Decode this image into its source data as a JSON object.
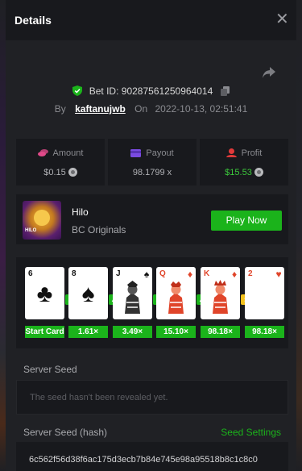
{
  "modal": {
    "title": "Details",
    "close_icon": "close-icon",
    "share_icon": "share-icon"
  },
  "bet": {
    "label": "Bet ID:",
    "id": "90287561250964014",
    "by_label": "By",
    "user": "kaftanujwb",
    "on_label": "On",
    "timestamp": "2022-10-13, 02:51:41"
  },
  "stats": [
    {
      "label": "Amount",
      "value": "$0.15",
      "icon": "coins-icon",
      "color": "#e14a8a"
    },
    {
      "label": "Payout",
      "value": "98.1799 x",
      "icon": "payout-card-icon",
      "color": "#7a4be0"
    },
    {
      "label": "Profit",
      "value": "$15.53",
      "icon": "profit-icon",
      "color": "#e03a3a"
    }
  ],
  "game": {
    "name": "Hilo",
    "provider": "BC Originals",
    "thumb_label": "HILO",
    "play_label": "Play Now"
  },
  "cards": [
    {
      "rank": "6",
      "suit": "♣",
      "color": "black",
      "arrow": "▲",
      "arrow_color": "green",
      "mult": "Start Card"
    },
    {
      "rank": "8",
      "suit": "♠",
      "color": "black",
      "arrow": "▲",
      "arrow_color": "green",
      "mult": "1.61×"
    },
    {
      "rank": "J",
      "suit": "♠",
      "color": "black",
      "arrow": "▲",
      "arrow_color": "green",
      "mult": "3.49×"
    },
    {
      "rank": "Q",
      "suit": "♦",
      "color": "red",
      "arrow": "▲",
      "arrow_color": "green",
      "mult": "15.10×"
    },
    {
      "rank": "K",
      "suit": "♦",
      "color": "red",
      "arrow": "»",
      "arrow_color": "yellow",
      "mult": "98.18×"
    },
    {
      "rank": "2",
      "suit": "♥",
      "color": "red",
      "arrow": "",
      "arrow_color": "",
      "mult": "98.18×"
    }
  ],
  "server_seed": {
    "label": "Server Seed",
    "placeholder": "The seed hasn't been revealed yet."
  },
  "server_seed_hash": {
    "label": "Server Seed (hash)",
    "settings_label": "Seed Settings",
    "value": "6c562f56d38f6ac175d3ecb7b84e745e98a95518b8c1c8c0"
  },
  "colors": {
    "accent_green": "#1bb31b",
    "background": "#202125",
    "panel": "#18191d"
  }
}
